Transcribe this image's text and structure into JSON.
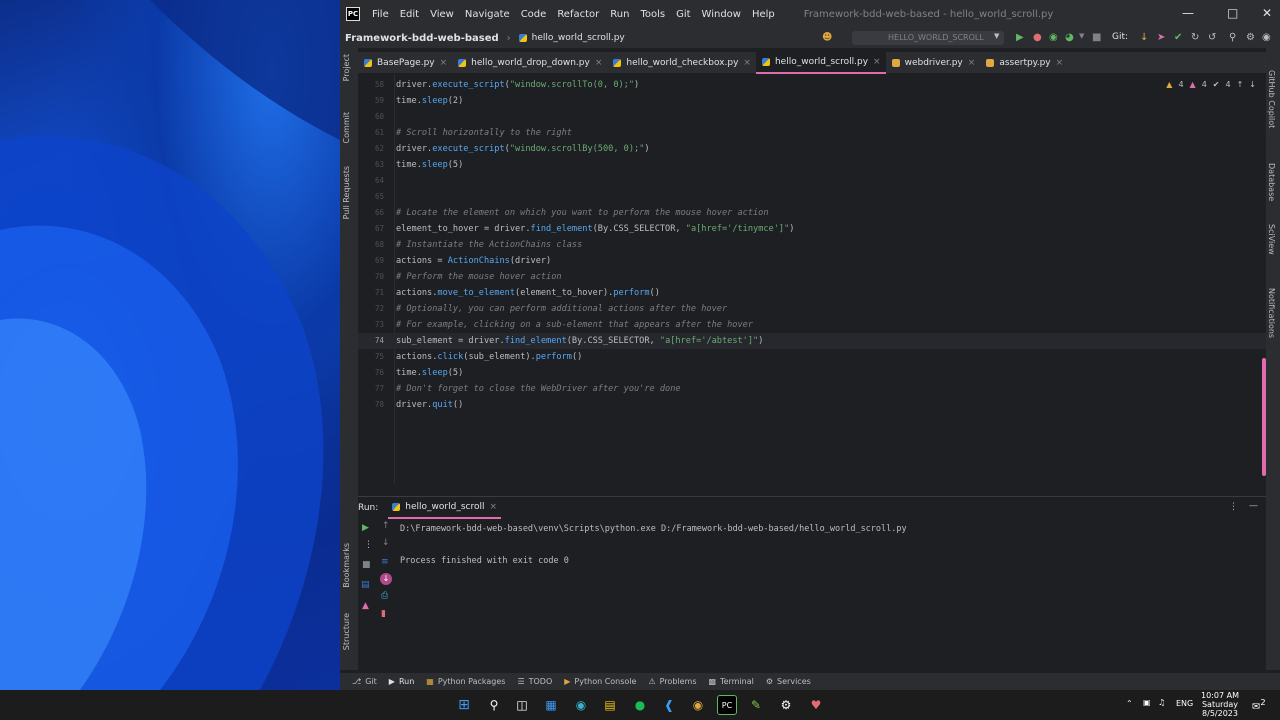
{
  "titlebar": {
    "logo": "PC",
    "menu": [
      "File",
      "Edit",
      "View",
      "Navigate",
      "Code",
      "Refactor",
      "Run",
      "Tools",
      "Git",
      "Window",
      "Help"
    ],
    "window_title": "Framework-bdd-web-based - hello_world_scroll.py"
  },
  "navbar": {
    "project": "Framework-bdd-web-based",
    "file": "hello_world_scroll.py",
    "run_config": "HELLO_WORLD_SCROLL",
    "git_label": "Git:"
  },
  "tabs": [
    {
      "label": "BasePage.py"
    },
    {
      "label": "hello_world_drop_down.py"
    },
    {
      "label": "hello_world_checkbox.py"
    },
    {
      "label": "hello_world_scroll.py"
    },
    {
      "label": "webdriver.py"
    },
    {
      "label": "assertpy.py"
    }
  ],
  "left_tools": [
    "Project",
    "Commit",
    "Pull Requests",
    "Bookmarks",
    "Structure"
  ],
  "right_tools": [
    "GitHub Copilot",
    "Database",
    "SciView",
    "Notifications"
  ],
  "editor": {
    "warnings": "4",
    "errors": "4",
    "weak": "4",
    "lines": [
      {
        "n": "58",
        "parts": [
          {
            "t": "driver."
          },
          {
            "t": "execute_script",
            "c": "fn"
          },
          {
            "t": "("
          },
          {
            "t": "\"window.scrollTo(0, 0);\"",
            "c": "str"
          },
          {
            "t": ")"
          }
        ]
      },
      {
        "n": "59",
        "parts": [
          {
            "t": "time."
          },
          {
            "t": "sleep",
            "c": "fn"
          },
          {
            "t": "(2)"
          }
        ]
      },
      {
        "n": "60",
        "parts": []
      },
      {
        "n": "61",
        "parts": [
          {
            "t": "# Scroll horizontally to the right",
            "c": "comment"
          }
        ]
      },
      {
        "n": "62",
        "parts": [
          {
            "t": "driver."
          },
          {
            "t": "execute_script",
            "c": "fn"
          },
          {
            "t": "("
          },
          {
            "t": "\"window.scrollBy(500, 0);\"",
            "c": "str"
          },
          {
            "t": ")"
          }
        ]
      },
      {
        "n": "63",
        "parts": [
          {
            "t": "time."
          },
          {
            "t": "sleep",
            "c": "fn"
          },
          {
            "t": "(5)"
          }
        ]
      },
      {
        "n": "64",
        "parts": []
      },
      {
        "n": "65",
        "parts": []
      },
      {
        "n": "66",
        "parts": [
          {
            "t": "# Locate the element on which you want to perform the mouse hover action",
            "c": "comment"
          }
        ]
      },
      {
        "n": "67",
        "parts": [
          {
            "t": "element_to_hover = driver."
          },
          {
            "t": "find_element",
            "c": "fn"
          },
          {
            "t": "(By.CSS_SELECTOR, "
          },
          {
            "t": "\"a[href='/tinymce']\"",
            "c": "str"
          },
          {
            "t": ")"
          }
        ]
      },
      {
        "n": "68",
        "parts": [
          {
            "t": "# Instantiate the ActionChains class",
            "c": "comment"
          }
        ]
      },
      {
        "n": "69",
        "parts": [
          {
            "t": "actions = "
          },
          {
            "t": "ActionChains",
            "c": "fn"
          },
          {
            "t": "(driver)"
          }
        ]
      },
      {
        "n": "70",
        "parts": [
          {
            "t": "# Perform the mouse hover action",
            "c": "comment"
          }
        ]
      },
      {
        "n": "71",
        "parts": [
          {
            "t": "actions."
          },
          {
            "t": "move_to_element",
            "c": "fn"
          },
          {
            "t": "(element_to_hover)."
          },
          {
            "t": "perform",
            "c": "fn"
          },
          {
            "t": "()"
          }
        ]
      },
      {
        "n": "72",
        "parts": [
          {
            "t": "# Optionally, you can perform additional actions after the hover",
            "c": "comment"
          }
        ]
      },
      {
        "n": "73",
        "parts": [
          {
            "t": "# For example, clicking on a sub-element that appears after the hover",
            "c": "comment"
          }
        ]
      },
      {
        "n": "74",
        "current": true,
        "parts": [
          {
            "t": "sub_element = driver."
          },
          {
            "t": "find_element",
            "c": "fn"
          },
          {
            "t": "(By.CSS_SELECTOR, "
          },
          {
            "t": "\"a[href='/abtest']\"",
            "c": "str"
          },
          {
            "t": ")"
          }
        ]
      },
      {
        "n": "75",
        "parts": [
          {
            "t": "actions."
          },
          {
            "t": "click",
            "c": "fn"
          },
          {
            "t": "(sub_element)."
          },
          {
            "t": "perform",
            "c": "fn"
          },
          {
            "t": "()"
          }
        ]
      },
      {
        "n": "76",
        "parts": [
          {
            "t": "time."
          },
          {
            "t": "sleep",
            "c": "fn"
          },
          {
            "t": "(5)"
          }
        ]
      },
      {
        "n": "77",
        "parts": [
          {
            "t": "# Don't forget to close the WebDriver after you're done",
            "c": "comment"
          }
        ]
      },
      {
        "n": "78",
        "parts": [
          {
            "t": "driver."
          },
          {
            "t": "quit",
            "c": "fn"
          },
          {
            "t": "()"
          }
        ]
      }
    ]
  },
  "run": {
    "label": "Run:",
    "tab": "hello_world_scroll",
    "command": "D:\\Framework-bdd-web-based\\venv\\Scripts\\python.exe D:/Framework-bdd-web-based/hello_world_scroll.py",
    "result": "Process finished with exit code 0"
  },
  "bottom_tabs": [
    {
      "label": "Git"
    },
    {
      "label": "Run"
    },
    {
      "label": "Python Packages"
    },
    {
      "label": "TODO"
    },
    {
      "label": "Python Console"
    },
    {
      "label": "Problems"
    },
    {
      "label": "Terminal"
    },
    {
      "label": "Services"
    }
  ],
  "taskbar": {
    "language": "ENG",
    "time": "10:07 AM",
    "day": "Saturday",
    "date": "8/5/2023",
    "notifications": "2"
  }
}
